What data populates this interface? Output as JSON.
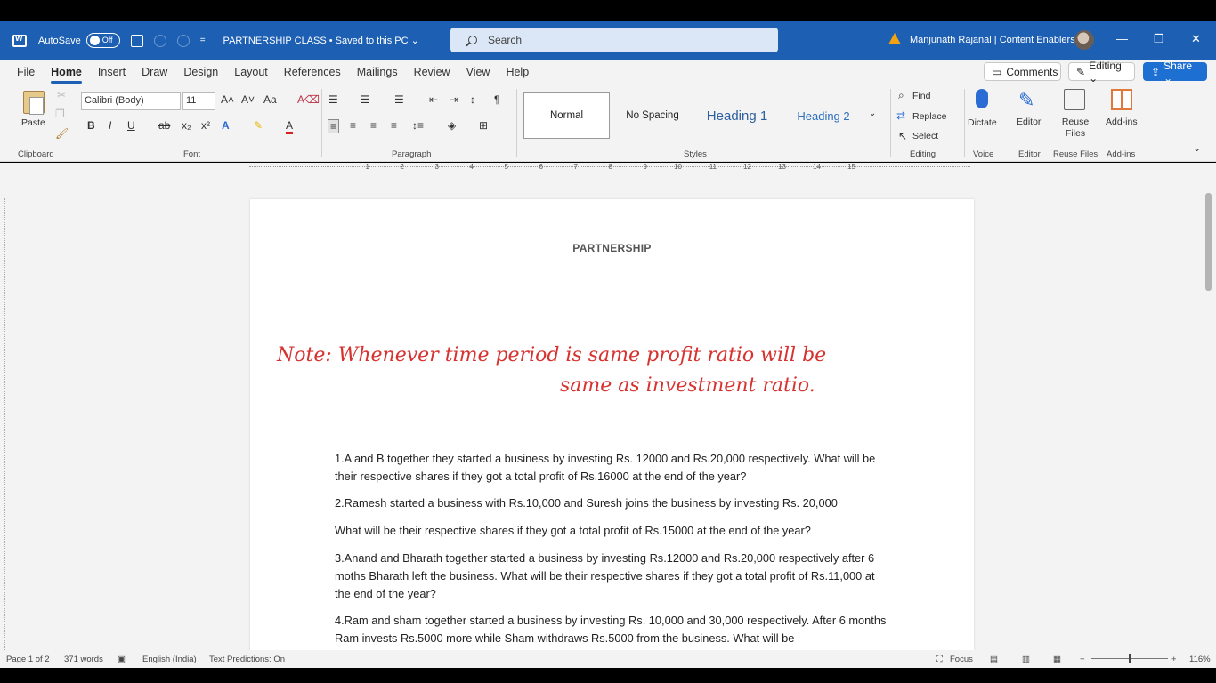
{
  "titlebar": {
    "autosave_label": "AutoSave",
    "autosave_state": "Off",
    "doc_title": "PARTNERSHIP CLASS • Saved to this PC ⌄",
    "search_placeholder": "Search",
    "user": "Manjunath Rajanal | Content Enablers",
    "minimize": "—",
    "restore": "❐",
    "close": "✕"
  },
  "menu": {
    "tabs": [
      "File",
      "Home",
      "Insert",
      "Draw",
      "Design",
      "Layout",
      "References",
      "Mailings",
      "Review",
      "View",
      "Help"
    ],
    "comments": "Comments",
    "editing": "Editing ⌄",
    "share": "Share ⌄"
  },
  "ribbon": {
    "paste": "Paste",
    "font_name": "Calibri (Body)",
    "font_size": "11",
    "styles": {
      "normal": "Normal",
      "nospacing": "No Spacing",
      "heading1": "Heading 1",
      "heading2": "Heading 2"
    },
    "find": "Find",
    "replace": "Replace",
    "select": "Select",
    "dictate": "Dictate",
    "editor": "Editor",
    "reuse_files": "Reuse Files",
    "addins": "Add-ins",
    "group_labels": {
      "clipboard": "Clipboard",
      "font": "Font",
      "paragraph": "Paragraph",
      "styles": "Styles",
      "editing": "Editing",
      "voice": "Voice",
      "editor": "Editor",
      "reuse": "Reuse Files",
      "addins": "Add-ins"
    }
  },
  "ruler": [
    "1",
    "2",
    "3",
    "4",
    "5",
    "6",
    "7",
    "8",
    "9",
    "10",
    "11",
    "12",
    "13",
    "14",
    "15"
  ],
  "document": {
    "heading": "PARTNERSHIP",
    "handwritten_line1": "Note: Whenever time period is same profit ratio will be",
    "handwritten_line2": "same as investment ratio.",
    "q1": "1.A and B together they started a business by investing Rs. 12000 and Rs.20,000 respectively. What will be their respective shares if they got a total profit of Rs.16000 at the end of the year?",
    "q2a": "2.Ramesh started a business with Rs.10,000 and Suresh joins the business by investing Rs. 20,000",
    "q2b": "What will be their respective shares if they got a total profit of Rs.15000 at the end of the year?",
    "q3_pre": "3.Anand and Bharath together started a business by investing Rs.12000 and Rs.20,000 respectively after 6",
    "q3_word": "moths",
    "q3_post": "Bharath left the business. What will be their respective shares if they got a total profit of Rs.11,000 at the end of the year?",
    "q4": "4.Ram and sham together started a business by investing Rs. 10,000 and 30,000 respectively. After 6 months Ram invests Rs.5000 more while Sham withdraws Rs.5000 from the business. What will be"
  },
  "status": {
    "page": "Page 1 of 2",
    "words": "371 words",
    "language": "English (India)",
    "predictions": "Text Predictions: On",
    "focus": "Focus",
    "zoom": "116%"
  }
}
